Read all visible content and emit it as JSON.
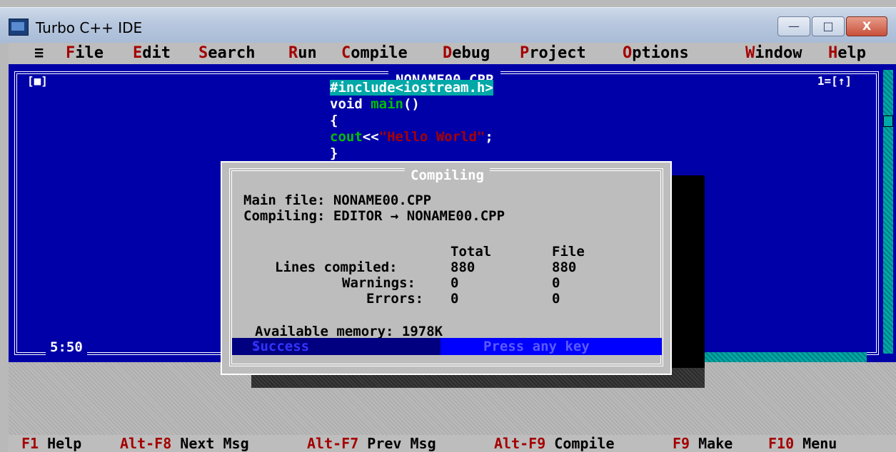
{
  "window": {
    "title": "Turbo C++ IDE",
    "buttons": {
      "minimize": "—",
      "maximize": "□",
      "close": "X"
    }
  },
  "menu": {
    "system": "≡",
    "items": [
      {
        "hot": "F",
        "rest": "ile"
      },
      {
        "hot": "E",
        "rest": "dit"
      },
      {
        "hot": "S",
        "rest": "earch"
      },
      {
        "hot": "R",
        "rest": "un"
      },
      {
        "hot": "C",
        "rest": "ompile"
      },
      {
        "hot": "D",
        "rest": "ebug"
      },
      {
        "hot": "P",
        "rest": "roject"
      },
      {
        "hot": "O",
        "rest": "ptions"
      },
      {
        "hot": "W",
        "rest": "indow"
      },
      {
        "hot": "H",
        "rest": "elp"
      }
    ]
  },
  "editor": {
    "file_title": "NONAME00.CPP",
    "close_box": "[■]",
    "window_number": "1=[↑]",
    "cursor_pos": "5:50",
    "code": {
      "line1": "#include<iostream.h>",
      "line2_kw": "void ",
      "line2_fn": "main",
      "line2_rest": "()",
      "line3": "{",
      "line4_fn": "cout",
      "line4_op": "<<",
      "line4_str": "\"Hello World\"",
      "line4_end": ";",
      "line5": "}"
    }
  },
  "dialog": {
    "title": "Compiling",
    "main_file": "Main file: NONAME00.CPP",
    "compiling": "Compiling: EDITOR → NONAME00.CPP",
    "col_total": "Total",
    "col_file": "File",
    "lines_label": "Lines compiled:",
    "lines_total": "880",
    "lines_file": "880",
    "warnings_label": "Warnings:",
    "warnings_total": "0",
    "warnings_file": "0",
    "errors_label": "Errors:",
    "errors_total": "0",
    "errors_file": "0",
    "memory": "Available memory: 1978K",
    "status_result": "Success",
    "status_sep": ":",
    "status_prompt": "Press any key"
  },
  "hints": [
    {
      "key": "F1",
      "label": " Help"
    },
    {
      "key": "Alt-F8",
      "label": " Next Msg"
    },
    {
      "key": "Alt-F7",
      "label": " Prev Msg"
    },
    {
      "key": "Alt-F9",
      "label": " Compile"
    },
    {
      "key": "F9",
      "label": " Make"
    },
    {
      "key": "F10",
      "label": " Menu"
    }
  ]
}
